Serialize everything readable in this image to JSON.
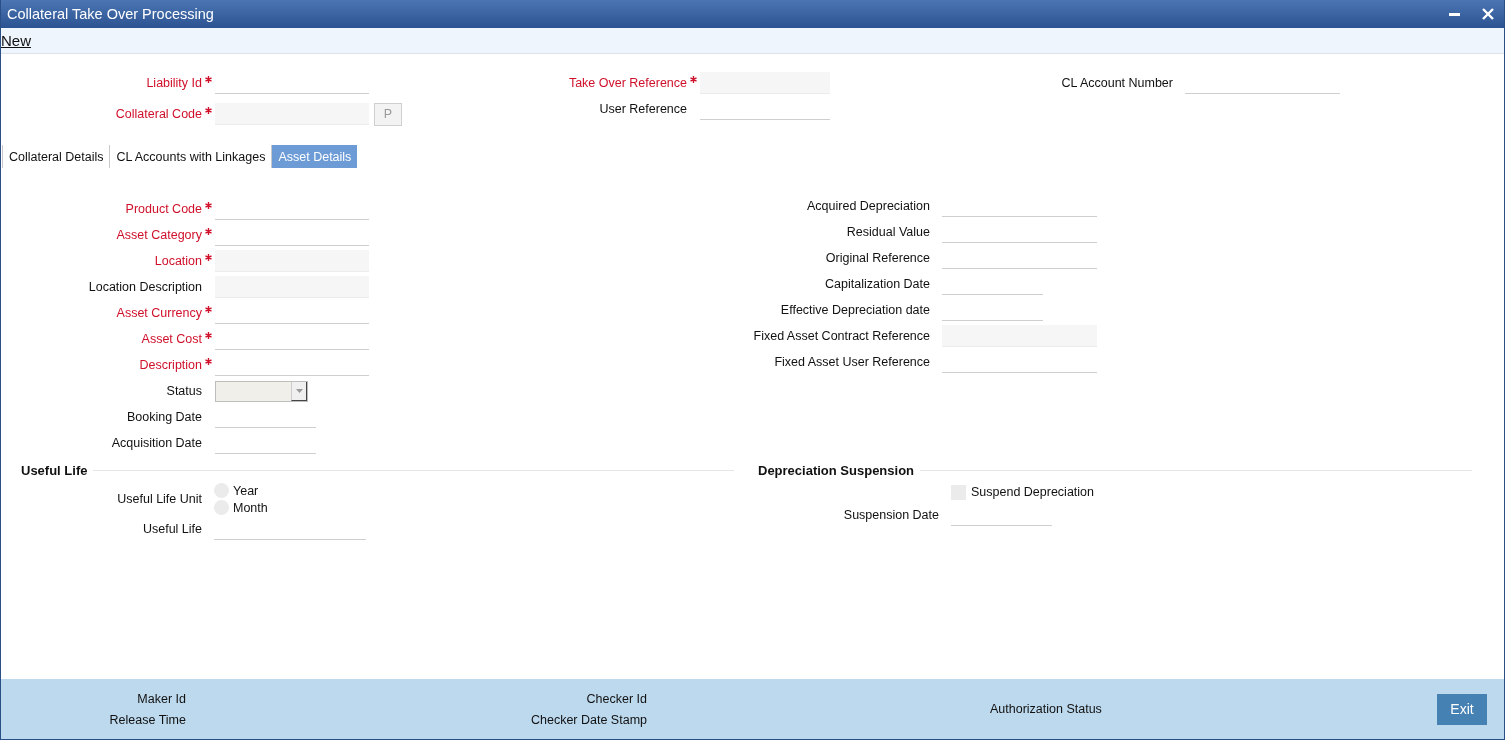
{
  "window": {
    "title": "Collateral Take Over Processing"
  },
  "toolbar": {
    "new_link": "New"
  },
  "header": {
    "columns": [
      [
        {
          "kind": "text",
          "label": "Liability Id",
          "required": true,
          "disabled": false
        },
        {
          "kind": "text",
          "label": "Collateral Code",
          "required": true,
          "disabled": true,
          "button": "P"
        }
      ],
      [
        {
          "kind": "text",
          "label": "Take Over Reference",
          "required": true,
          "disabled": true
        },
        {
          "kind": "text",
          "label": "User Reference",
          "required": false,
          "disabled": false
        }
      ],
      [
        {
          "kind": "text",
          "label": "CL Account Number",
          "required": false,
          "disabled": false
        }
      ]
    ]
  },
  "tabs": [
    {
      "label": "Collateral Details",
      "selected": false
    },
    {
      "label": "CL Accounts with Linkages",
      "selected": false
    },
    {
      "label": "Asset Details",
      "selected": true
    }
  ],
  "asset_details": {
    "columns": [
      [
        {
          "kind": "text",
          "label": "Product Code",
          "required": true,
          "disabled": false
        },
        {
          "kind": "text",
          "label": "Asset Category",
          "required": true,
          "disabled": false
        },
        {
          "kind": "text",
          "label": "Location",
          "required": true,
          "disabled": true
        },
        {
          "kind": "text",
          "label": "Location Description",
          "required": false,
          "disabled": true
        },
        {
          "kind": "text",
          "label": "Asset Currency",
          "required": true,
          "disabled": false
        },
        {
          "kind": "text",
          "label": "Asset Cost",
          "required": true,
          "disabled": false
        },
        {
          "kind": "text",
          "label": "Description",
          "required": true,
          "disabled": false
        },
        {
          "kind": "select",
          "label": "Status",
          "required": false,
          "disabled": true
        },
        {
          "kind": "date",
          "label": "Booking Date",
          "required": false,
          "disabled": false
        },
        {
          "kind": "date",
          "label": "Acquisition Date",
          "required": false,
          "disabled": false
        }
      ],
      [
        {
          "kind": "text",
          "label": "Acquired Depreciation",
          "required": false,
          "disabled": false
        },
        {
          "kind": "text",
          "label": "Residual Value",
          "required": false,
          "disabled": false
        },
        {
          "kind": "text",
          "label": "Original Reference",
          "required": false,
          "disabled": false
        },
        {
          "kind": "date",
          "label": "Capitalization Date",
          "required": false,
          "disabled": false
        },
        {
          "kind": "date",
          "label": "Effective Depreciation date",
          "required": false,
          "disabled": false
        },
        {
          "kind": "text",
          "label": "Fixed Asset Contract Reference",
          "required": false,
          "disabled": true
        },
        {
          "kind": "text",
          "label": "Fixed Asset User Reference",
          "required": false,
          "disabled": false
        }
      ]
    ]
  },
  "sections": [
    {
      "title": "Useful Life",
      "items": [
        {
          "kind": "radio_group",
          "label": "Useful Life Unit",
          "options": [
            {
              "label": "Year",
              "selected": false
            },
            {
              "label": "Month",
              "selected": false
            }
          ]
        },
        {
          "kind": "text",
          "label": "Useful Life",
          "required": false,
          "disabled": false
        }
      ]
    },
    {
      "title": "Depreciation Suspension",
      "items": [
        {
          "kind": "checkbox",
          "label": "Suspend Depreciation",
          "checked": false
        },
        {
          "kind": "date",
          "label": "Suspension Date",
          "required": false,
          "disabled": false
        }
      ]
    }
  ],
  "footer": {
    "columns": [
      [
        "Maker Id",
        "Release Time"
      ],
      [
        "Checker Id",
        "Checker Date Stamp"
      ],
      [
        "Authorization Status"
      ]
    ],
    "exit_button": "Exit"
  }
}
